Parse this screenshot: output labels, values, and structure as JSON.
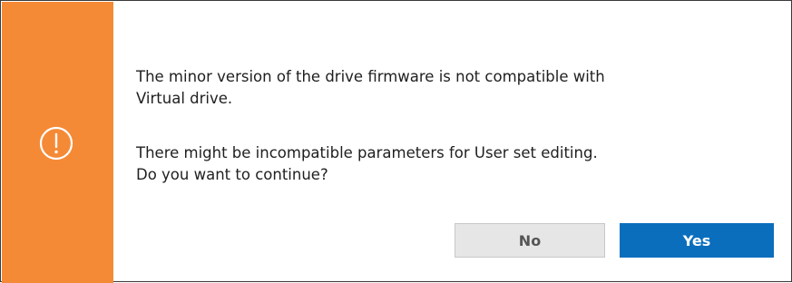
{
  "dialog": {
    "message_line1": "The minor version of the drive firmware is not compatible with",
    "message_line2": "Virtual drive.",
    "message_line3": "There might be incompatible parameters for User set editing.",
    "message_line4": "Do you want to continue?",
    "icon": "exclamation-circle-icon",
    "accent_color": "#f58a36"
  },
  "buttons": {
    "no_label": "No",
    "yes_label": "Yes",
    "yes_color": "#0a6ebd"
  }
}
